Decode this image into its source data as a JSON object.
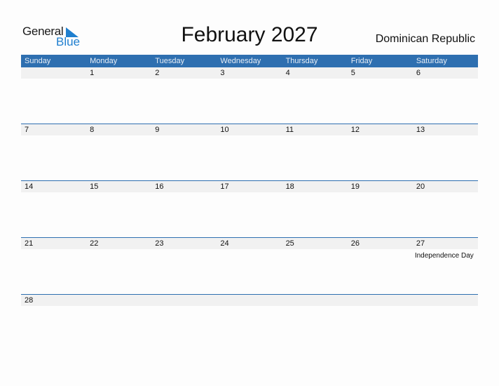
{
  "logo": {
    "general": "General",
    "blue": "Blue"
  },
  "title": "February 2027",
  "country": "Dominican Republic",
  "weekdays": [
    "Sunday",
    "Monday",
    "Tuesday",
    "Wednesday",
    "Thursday",
    "Friday",
    "Saturday"
  ],
  "weeks": [
    {
      "days": [
        "",
        "1",
        "2",
        "3",
        "4",
        "5",
        "6"
      ]
    },
    {
      "days": [
        "7",
        "8",
        "9",
        "10",
        "11",
        "12",
        "13"
      ]
    },
    {
      "days": [
        "14",
        "15",
        "16",
        "17",
        "18",
        "19",
        "20"
      ]
    },
    {
      "days": [
        "21",
        "22",
        "23",
        "24",
        "25",
        "26",
        "27"
      ]
    },
    {
      "days": [
        "28",
        "",
        "",
        "",
        "",
        "",
        ""
      ]
    }
  ],
  "holidays": [
    {
      "day": "27",
      "name": "Independence Day"
    }
  ],
  "colors": {
    "header": "#2e6fb0",
    "brand_blue": "#1f7fcf",
    "band": "#f1f1f1"
  }
}
